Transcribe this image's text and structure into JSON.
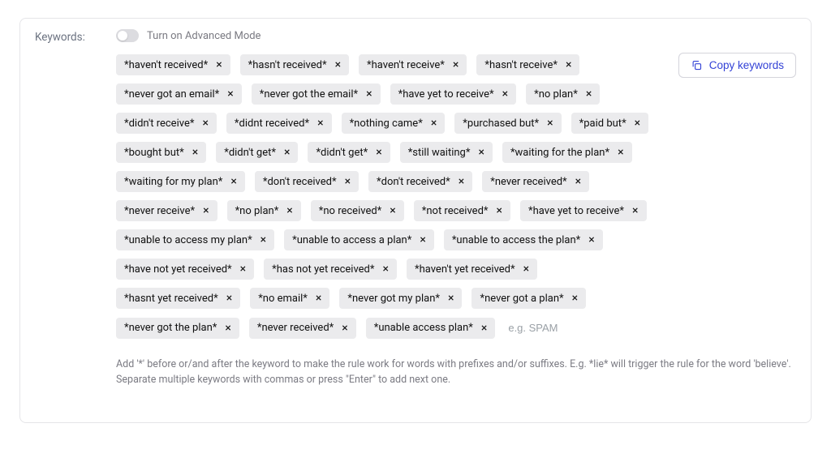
{
  "label": "Keywords:",
  "toggle": {
    "label": "Turn on Advanced Mode",
    "on": false
  },
  "copy_button": "Copy keywords",
  "keywords": [
    "*haven't received*",
    "*hasn't received*",
    "*haven't receive*",
    "*hasn't receive*",
    "*never got an email*",
    "*never got the email*",
    "*have yet to receive*",
    "*no plan*",
    "*didn't receive*",
    "*didnt received*",
    "*nothing came*",
    "*purchased but*",
    "*paid but*",
    "*bought but*",
    "*didn't get*",
    "*didn't get*",
    "*still waiting*",
    "*waiting for the plan*",
    "*waiting for my plan*",
    "*don't received*",
    "*don't received*",
    "*never received*",
    "*never receive*",
    "*no plan*",
    "*no received*",
    "*not received*",
    "*have yet to receive*",
    "*unable to access my plan*",
    "*unable to access a plan*",
    "*unable to access the plan*",
    "*have not yet received*",
    "*has not yet received*",
    "*haven't yet received*",
    "*hasnt yet received*",
    "*no email*",
    "*never got my plan*",
    "*never got a plan*",
    "*never got the plan*",
    "*never received*",
    "*unable access plan*"
  ],
  "input_placeholder": "e.g. SPAM",
  "help": "Add '*' before or/and after the keyword to make the rule work for words with prefixes and/or suffixes. E.g. *lie* will trigger the rule for the word 'believe'. Separate multiple keywords with commas or press \"Enter\" to add next one."
}
